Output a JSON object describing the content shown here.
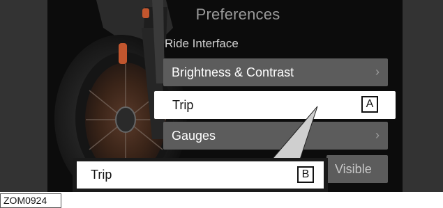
{
  "screen": {
    "title": "Preferences",
    "section_label": "Ride Interface",
    "menu_items": [
      {
        "label": "Brightness & Contrast",
        "chevron": "›"
      },
      {
        "label": "Trip",
        "callout": "A"
      },
      {
        "label": "Gauges",
        "chevron": "›"
      },
      {
        "label": "Visible"
      }
    ]
  },
  "zoom_callout": {
    "label": "Trip",
    "callout": "B"
  },
  "figure_id": "ZOM0924",
  "colors": {
    "bezel": "#333333",
    "screen_bg": "#0c0c0c",
    "menu_item_bg": "#5c5c5c",
    "selected_item_bg": "#ffffff",
    "title_text": "#9a9a9a"
  },
  "icons": {
    "chevron": "chevron-right-icon"
  }
}
